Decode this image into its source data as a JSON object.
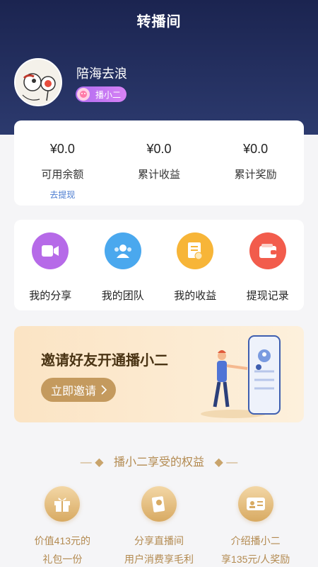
{
  "header": {
    "title": "转播间",
    "username": "陪海去浪",
    "role_badge": "播小二"
  },
  "balances": [
    {
      "value": "¥0.0",
      "label": "可用余额",
      "link": "去提现"
    },
    {
      "value": "¥0.0",
      "label": "累计收益"
    },
    {
      "value": "¥0.0",
      "label": "累计奖励"
    }
  ],
  "menu": [
    {
      "label": "我的分享",
      "icon": "video-icon",
      "color": "#b66ae8"
    },
    {
      "label": "我的团队",
      "icon": "team-icon",
      "color": "#4aa8ee"
    },
    {
      "label": "我的收益",
      "icon": "document-icon",
      "color": "#f7b538"
    },
    {
      "label": "提现记录",
      "icon": "wallet-icon",
      "color": "#f25c4c"
    }
  ],
  "invite": {
    "title": "邀请好友开通播小二",
    "button": "立即邀请"
  },
  "benefits": {
    "title": "播小二享受的权益",
    "items": [
      {
        "line1": "价值413元的",
        "line2": "礼包一份",
        "icon": "gift-icon"
      },
      {
        "line1": "分享直播间",
        "line2": "用户消费享毛利",
        "icon": "share-card-icon"
      },
      {
        "line1": "介绍播小二",
        "line2": "享135元/人奖励",
        "icon": "id-card-icon"
      }
    ]
  }
}
